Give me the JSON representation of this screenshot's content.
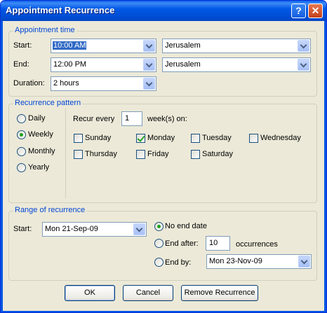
{
  "window": {
    "title": "Appointment Recurrence",
    "help_button": "?",
    "close_button": "✕"
  },
  "appointment_time": {
    "legend": "Appointment time",
    "start_label": "Start:",
    "start_time": "10:00 AM",
    "start_timezone": "Jerusalem",
    "end_label": "End:",
    "end_time": "12:00 PM",
    "end_timezone": "Jerusalem",
    "duration_label": "Duration:",
    "duration": "2 hours"
  },
  "recurrence_pattern": {
    "legend": "Recurrence pattern",
    "options": [
      "Daily",
      "Weekly",
      "Monthly",
      "Yearly"
    ],
    "selected": "Weekly",
    "recur_every_label": "Recur every",
    "recur_every_value": "1",
    "weeks_on_label": "week(s) on:",
    "days": [
      {
        "label": "Sunday",
        "checked": false
      },
      {
        "label": "Monday",
        "checked": true
      },
      {
        "label": "Tuesday",
        "checked": false
      },
      {
        "label": "Wednesday",
        "checked": false
      },
      {
        "label": "Thursday",
        "checked": false
      },
      {
        "label": "Friday",
        "checked": false
      },
      {
        "label": "Saturday",
        "checked": false
      }
    ]
  },
  "range": {
    "legend": "Range of recurrence",
    "start_label": "Start:",
    "start_date": "Mon 21-Sep-09",
    "no_end_label": "No end date",
    "end_after_label": "End after:",
    "end_after_value": "10",
    "occurrences_label": "occurrences",
    "end_by_label": "End by:",
    "end_by_date": "Mon 23-Nov-09",
    "selected": "no_end"
  },
  "buttons": {
    "ok": "OK",
    "cancel": "Cancel",
    "remove": "Remove Recurrence"
  }
}
